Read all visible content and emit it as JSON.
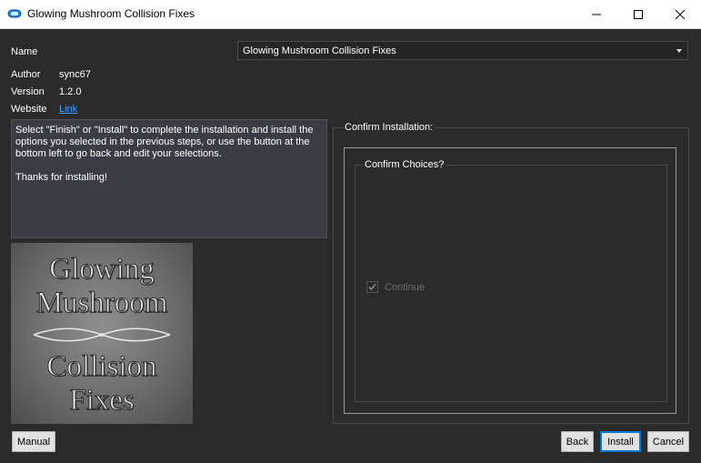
{
  "window": {
    "title": "Glowing Mushroom Collision Fixes",
    "controls": [
      "minimize-icon",
      "maximize-icon",
      "close-icon"
    ]
  },
  "info": {
    "name_label": "Name",
    "name_value": "Glowing Mushroom Collision Fixes",
    "author_label": "Author",
    "author_value": "sync67",
    "version_label": "Version",
    "version_value": "1.2.0",
    "website_label": "Website",
    "website_link": "Link"
  },
  "description": {
    "paragraph1": "Select \"Finish\" or \"Install\" to complete the installation and install the options you selected in the previous steps, or use the button at the bottom left to go back and edit your selections.",
    "paragraph2": "Thanks for installing!"
  },
  "image": {
    "line1": "Glowing",
    "line2": "Mushroom",
    "line3": "Collision",
    "line4": "Fixes"
  },
  "confirm": {
    "group_title": "Confirm Installation:",
    "inner_title": "Confirm Choices?",
    "checkbox_label": "Continue",
    "checkbox_checked": true,
    "checkbox_enabled": false
  },
  "buttons": {
    "manual": "Manual",
    "back": "Back",
    "install": "Install",
    "cancel": "Cancel"
  },
  "colors": {
    "background": "#2b2b2b",
    "link": "#3d9fff",
    "focus": "#0078d7"
  }
}
